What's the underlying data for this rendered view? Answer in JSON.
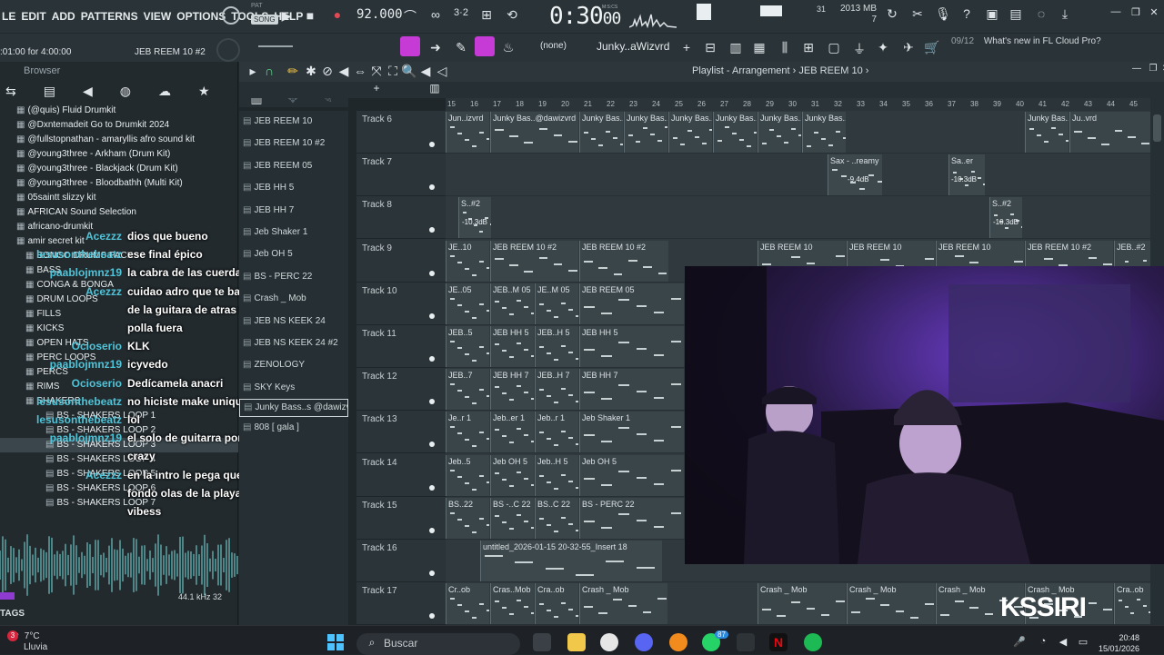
{
  "menu": [
    "LE",
    "EDIT",
    "ADD",
    "PATTERNS",
    "VIEW",
    "OPTIONS",
    "TOOLS",
    "HELP"
  ],
  "transport": {
    "mode": "SONG",
    "mode_pat": "PAT",
    "bpm": "92.000",
    "time": "0:30",
    "time_small": "00",
    "time_unit": "M:S:CS"
  },
  "system": {
    "memory": "2013 MB",
    "cpu_num": "31",
    "poly": "7"
  },
  "song_position": ":01:00 for 4:00:00",
  "current_pattern": "JEB REEM 10 #2",
  "snap": "(none)",
  "instrument_selector": "Junky..aWizvrd",
  "news": {
    "count": "09/12",
    "text": "What's new in FL Cloud Pro?"
  },
  "browser": {
    "title": "Browser",
    "items": [
      {
        "label": "(@quis) Fluid Drumkit"
      },
      {
        "label": "@Dxntemadeit Go to Drumkit 2024"
      },
      {
        "label": "@fullstopnathan - amaryllis afro sound kit"
      },
      {
        "label": "@young3three - Arkham (Drum Kit)"
      },
      {
        "label": "@young3three - Blackjack (Drum Kit)"
      },
      {
        "label": "@young3three - Bloodbathh (Multi Kit)"
      },
      {
        "label": "05saintt slizzy kit"
      },
      {
        "label": "AFRICAN Sound Selection"
      },
      {
        "label": "africano-drumkit"
      },
      {
        "label": "amir secret kit"
      },
      {
        "label": "BONGO DRUMS PACK"
      },
      {
        "label": "BASS"
      },
      {
        "label": "CONGA & BONGA"
      },
      {
        "label": "DRUM LOOPS"
      },
      {
        "label": "FILLS"
      },
      {
        "label": "KICKS"
      },
      {
        "label": "OPEN HATS"
      },
      {
        "label": "PERC LOOPS"
      },
      {
        "label": "PERCS"
      },
      {
        "label": "RIMS"
      },
      {
        "label": "SHAKERS"
      },
      {
        "label": "BS - SHAKERS LOOP 1"
      },
      {
        "label": "BS - SHAKERS LOOP 2"
      },
      {
        "label": "BS - SHAKERS LOOP 3"
      },
      {
        "label": "BS - SHAKERS LOOP 4"
      },
      {
        "label": "BS - SHAKERS LOOP 5"
      },
      {
        "label": "BS - SHAKERS LOOP 6"
      },
      {
        "label": "BS - SHAKERS LOOP 7"
      }
    ],
    "sample_rate": "44.1 kHz 32",
    "tags": "TAGS"
  },
  "chat": [
    {
      "user": "Acezzz",
      "msg": "dios que bueno"
    },
    {
      "user": "lesusonthebeatz",
      "msg": "ese final épico"
    },
    {
      "user": "paablojmnz19",
      "msg": "la cabra de las cuerdas"
    },
    {
      "user": "Acezzz",
      "msg": "cuidao adro que te banean que el"
    },
    {
      "user": "",
      "msg": "de la guitara de atras va con la"
    },
    {
      "user": "",
      "msg": "polla fuera"
    },
    {
      "user": "Ocioserio",
      "msg": "KLK"
    },
    {
      "user": "paablojmnz19",
      "msg": "icyvedo"
    },
    {
      "user": "Ocioserio",
      "msg": "Dedícamela anacri"
    },
    {
      "user": "lesusonthebeatz",
      "msg": "no hiciste make unique"
    },
    {
      "user": "lesusonthebeatz",
      "msg": "lol"
    },
    {
      "user": "paablojmnz19",
      "msg": "el solo de guitarra por abajo is"
    },
    {
      "user": "",
      "msg": "crazy"
    },
    {
      "user": "Acezzz",
      "msg": "en la intro le pega que suene de"
    },
    {
      "user": "",
      "msg": "fondo olas de la playa me da esas"
    },
    {
      "user": "",
      "msg": "vibess"
    }
  ],
  "patterns": [
    "JEB REEM 10",
    "JEB REEM 10 #2",
    "JEB REEM 05",
    "JEB HH 5",
    "JEB HH 7",
    "Jeb Shaker 1",
    "Jeb OH 5",
    "BS - PERC 22",
    "Crash _ Mob",
    "JEB NS KEEK 24",
    "JEB NS KEEK 24 #2",
    "ZENOLOGY",
    "SKY Keys",
    "Junky Bass..s @dawizvrd",
    "808 [ gala ]"
  ],
  "playlist": {
    "title": "Playlist - Arrangement",
    "pattern": "JEB REEM 10",
    "ruler": [
      "15",
      "16",
      "17",
      "18",
      "19",
      "20",
      "21",
      "22",
      "23",
      "24",
      "25",
      "26",
      "27",
      "28",
      "29",
      "30",
      "31",
      "32",
      "33",
      "34",
      "35",
      "36",
      "37",
      "38",
      "39",
      "40",
      "41",
      "42",
      "43",
      "44",
      "45"
    ],
    "tracks": [
      "Track 6",
      "Track 7",
      "Track 8",
      "Track 9",
      "Track 10",
      "Track 11",
      "Track 12",
      "Track 13",
      "Track 14",
      "Track 15",
      "Track 16",
      "Track 17"
    ],
    "clip_labels": {
      "t6": [
        "Jun..izvrd",
        "Junky Bas..@dawizvrd",
        "Junky Bas..@dawizvrd",
        "Junky Bas..@dawizvrd",
        "Junky Bas..@dawizvrd",
        "Junky Bas..@dawizvrd",
        "Junky Bas..@dawizvrd",
        "Junky Bas..@dawizvrd",
        "Junky Bas..@dawizvrd",
        "Ju..vrd"
      ],
      "t7": [
        "Sax - ..reamy",
        "Sa..er"
      ],
      "t7_db": [
        "-9.4dB",
        "-10.3dB"
      ],
      "t8": [
        "S..#2",
        "S..#2"
      ],
      "t8_db": [
        "-10.3dB",
        "-10.3dB"
      ],
      "t9": [
        "JE..10",
        "JEB REEM 10 #2",
        "JEB REEM 10 #2",
        "JEB REEM 10",
        "JEB REEM 10",
        "JEB REEM 10",
        "JEB REEM 10 #2",
        "JEB..#2"
      ],
      "t10": [
        "JE..05",
        "JEB..M 05",
        "JE..M 05",
        "JEB REEM 05"
      ],
      "t11": [
        "JEB..5",
        "JEB HH 5",
        "JEB..H 5",
        "JEB HH 5"
      ],
      "t12": [
        "JEB..7",
        "JEB HH 7",
        "JEB..H 7",
        "JEB HH 7"
      ],
      "t13": [
        "Je..r 1",
        "Jeb..er 1",
        "Jeb..r 1",
        "Jeb Shaker 1"
      ],
      "t14": [
        "Jeb..5",
        "Jeb OH 5",
        "Jeb..H 5",
        "Jeb OH 5"
      ],
      "t15": [
        "BS..22",
        "BS -..C 22",
        "BS..C 22",
        "BS - PERC 22"
      ],
      "t16": [
        "untitled_2026-01-15 20-32-55_Insert 18"
      ],
      "t17": [
        "Cr..ob",
        "Cras..Mob",
        "Cra..ob",
        "Crash _ Mob",
        "Crash _ Mob",
        "Crash _ Mob",
        "Crash _ Mob",
        "Crash _ Mob",
        "Cra..ob"
      ]
    }
  },
  "overlay_logo": "KSSIRI",
  "taskbar": {
    "temp": "7°C",
    "weather": "Lluvia",
    "search": "Buscar",
    "time": "20:48",
    "date": "15/01/2026",
    "badge": "3",
    "badge2": "87"
  }
}
